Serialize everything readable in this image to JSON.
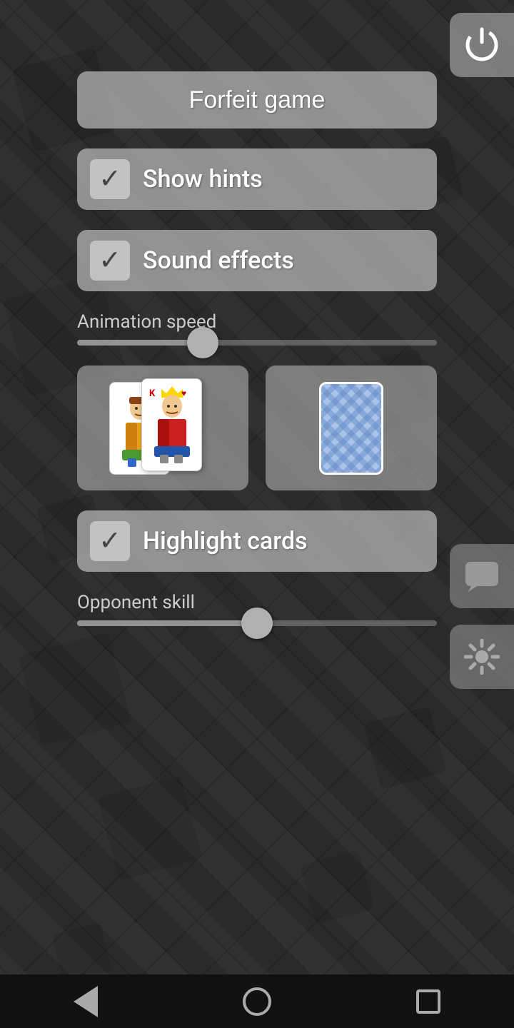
{
  "background": {
    "color": "#2a2a2a"
  },
  "header": {
    "power_button_label": "Power"
  },
  "forfeit": {
    "label": "Forfeit game"
  },
  "show_hints": {
    "label": "Show hints",
    "checked": true
  },
  "sound_effects": {
    "label": "Sound effects",
    "checked": true
  },
  "animation_speed": {
    "label": "Animation speed",
    "value": 35,
    "min": 0,
    "max": 100
  },
  "card_face_picker": {
    "label": "Card face"
  },
  "card_back_picker": {
    "label": "Card back"
  },
  "highlight_cards": {
    "label": "Highlight cards",
    "checked": true
  },
  "opponent_skill": {
    "label": "Opponent skill",
    "value": 50,
    "min": 0,
    "max": 100
  },
  "right_buttons": {
    "chat_label": "Chat",
    "settings_label": "Settings"
  },
  "nav": {
    "back_label": "Back",
    "home_label": "Home",
    "recents_label": "Recents"
  }
}
